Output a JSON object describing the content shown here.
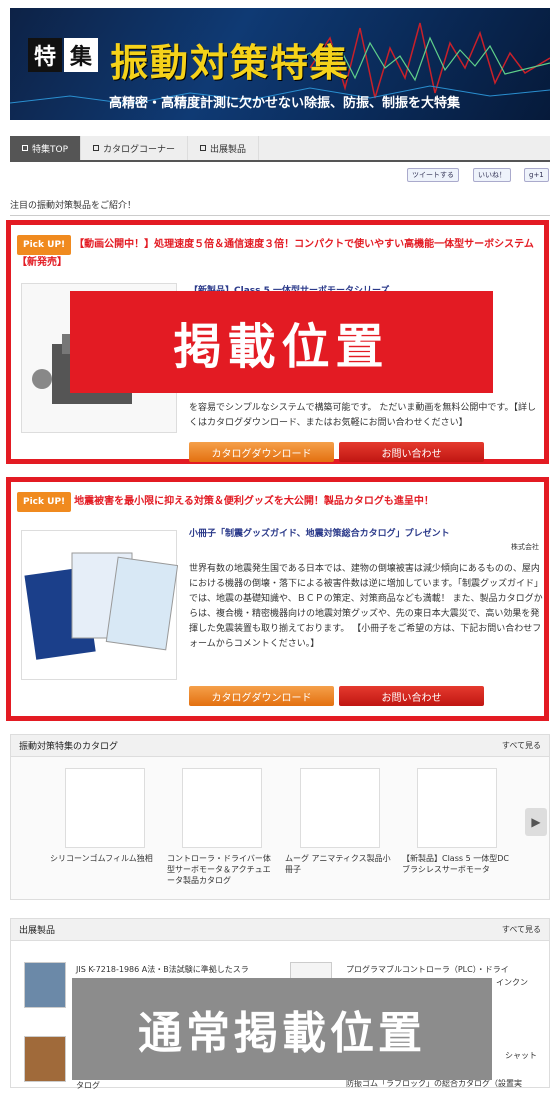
{
  "banner": {
    "tag1": "特",
    "tag2": "集",
    "title": "振動対策特集",
    "subtitle": "高精密・高精度計測に欠かせない除振、防振、制振を大特集"
  },
  "tabs": [
    {
      "label": "特集TOP"
    },
    {
      "label": "カタログコーナー"
    },
    {
      "label": "出展製品"
    }
  ],
  "social": {
    "tweet": "ツイートする",
    "like": "いいね！",
    "gplus": "g+1"
  },
  "section_heading": "注目の振動対策製品をご紹介！",
  "featured": [
    {
      "pickup": "Pick UP!",
      "headline": "【動画公開中！】処理速度５倍＆通信速度３倍！コンパクトで使いやすい高機能一体型サーボシステム【新発売】",
      "subtitle": "【新製品】Class 5 一体型サーボモータシリーズ",
      "desc": "を容易でシンプルなシステムで構築可能です。 ただいま動画を無料公開中です。【詳しくはカタログダウンロード、またはお気軽にお問い合わせください】",
      "download": "カタログダウンロード",
      "inquiry": "お問い合わせ"
    },
    {
      "pickup": "Pick UP!",
      "headline": "地震被害を最小限に抑える対策＆便利グッズを大公開！製品カタログも進呈中！",
      "subtitle": "小冊子「制震グッズガイド、地震対策総合カタログ」プレゼント",
      "company": "株式会社",
      "desc": "世界有数の地震発生国である日本では、建物の倒壊被害は減少傾向にあるものの、屋内における機器の倒壊・落下による被害件数は逆に増加しています。「制震グッズガイド」では、地震の基礎知識や、ＢＣＰの策定、対策商品なども満載！ また、製品カタログからは、複合機・精密機器向けの地震対策グッズや、先の東日本大震災で、高い効果を発揮した免震装置も取り揃えております。 【小冊子をご希望の方は、下記お問い合わせフォームからコメントください。】",
      "download": "カタログダウンロード",
      "inquiry": "お問い合わせ"
    }
  ],
  "overlay_featured": "掲載位置",
  "catalog": {
    "heading": "振動対策特集のカタログ",
    "more": "すべて見る",
    "items": [
      {
        "label": "シリコーンゴムフィルム独相"
      },
      {
        "label": "コントローラ・ドライバー体型サーボモータ＆アクチュエータ製品カタログ"
      },
      {
        "label": "ムーグ アニマティクス製品小冊子"
      },
      {
        "label": "【新製品】Class 5 一体型DCブラシレスサーボモータ"
      }
    ]
  },
  "products": {
    "heading": "出展製品",
    "more": "すべて見る",
    "items": [
      {
        "label": "JIS K-7218-1986 A法・B法試験に準拠したスラ"
      },
      {
        "label": "プログラマブルコントローラ（PLC）・ドライ"
      },
      {
        "label": "インクン"
      },
      {
        "label": "シャット"
      },
      {
        "label": "タログ"
      },
      {
        "label": "防振ゴム「ラブロック」の総合カタログ（設置実"
      }
    ]
  },
  "overlay_normal": "通常掲載位置",
  "colors": {
    "accent": "#e31b23",
    "orange": "#f08a1f",
    "navy": "#0f3a74",
    "gold": "#f5d21a"
  }
}
